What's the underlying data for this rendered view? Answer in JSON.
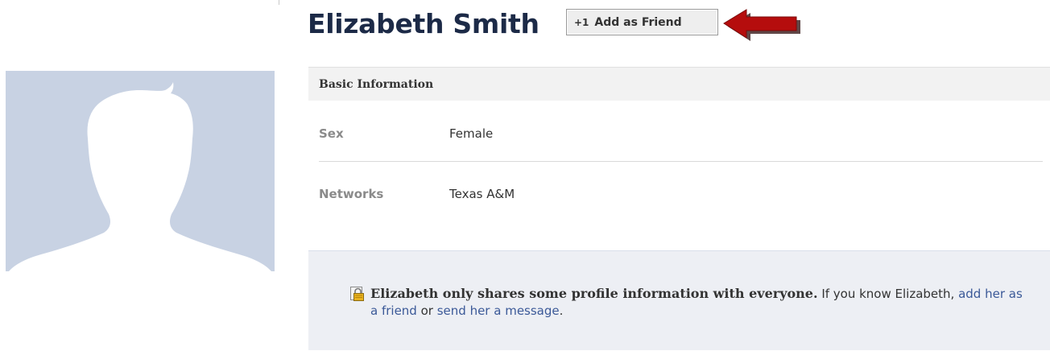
{
  "profile": {
    "name": "Elizabeth Smith",
    "add_friend_label": "Add as Friend",
    "add_friend_icon_text": "+1"
  },
  "basic_info": {
    "header": "Basic Information",
    "rows": [
      {
        "label": "Sex",
        "value": "Female"
      },
      {
        "label": "Networks",
        "value": "Texas A&M"
      }
    ]
  },
  "privacy_notice": {
    "bold_text": "Elizabeth only shares some profile information with everyone.",
    "text_before": " If you know Elizabeth, ",
    "link_add_friend": "add her as a friend",
    "text_middle": " or ",
    "link_send_message": "send her a message",
    "text_end": "."
  },
  "icons": {
    "avatar": "default-silhouette-icon",
    "arrow": "red-arrow-pointing-left-icon",
    "lock": "lock-icon",
    "plus": "plus-one-icon"
  },
  "colors": {
    "name": "#1c2a47",
    "link": "#3b5998",
    "avatar_bg": "#c8d2e3",
    "notice_bg": "#edeff4",
    "arrow": "#b50d0d"
  }
}
